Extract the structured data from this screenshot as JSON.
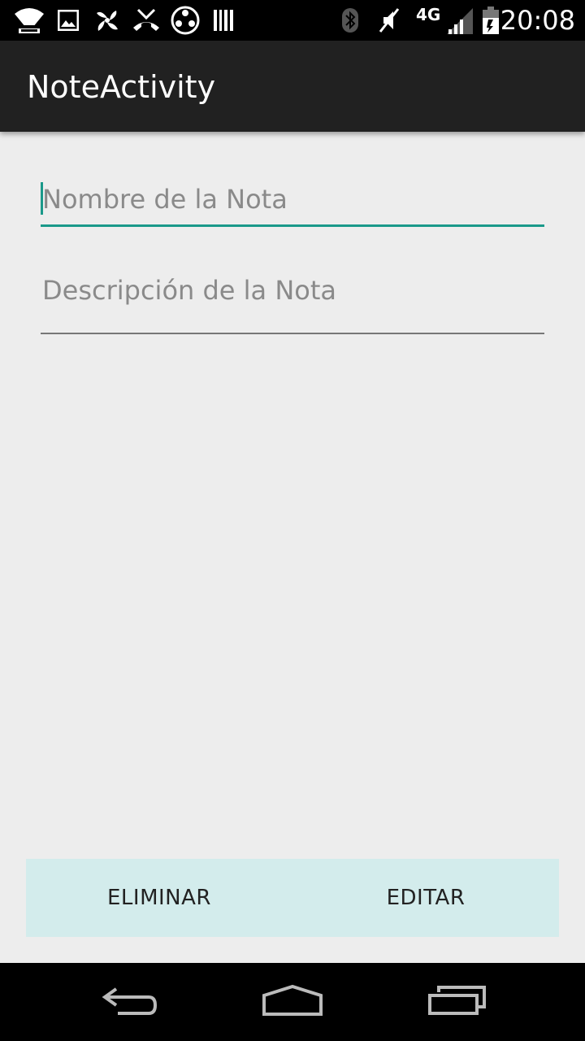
{
  "status_bar": {
    "time": "20:08",
    "network": "4G",
    "icons": [
      "wifi-icon",
      "image-icon",
      "pinwheel-icon",
      "missed-call-icon",
      "media-icon",
      "barcode-icon",
      "bluetooth-icon",
      "mute-icon",
      "signal-icon",
      "battery-icon"
    ]
  },
  "action_bar": {
    "title": "NoteActivity"
  },
  "form": {
    "name_placeholder": "Nombre de la Nota",
    "name_value": "",
    "description_placeholder": "Descripción de la Nota",
    "description_value": ""
  },
  "buttons": {
    "delete_label": "ELIMINAR",
    "edit_label": "EDITAR"
  },
  "nav_bar": {
    "icons": [
      "back-icon",
      "home-icon",
      "recents-icon"
    ]
  },
  "colors": {
    "accent": "#1a998a",
    "button_bar_bg": "#d3ecec",
    "action_bar_bg": "#212121",
    "screen_bg": "#ededed"
  }
}
